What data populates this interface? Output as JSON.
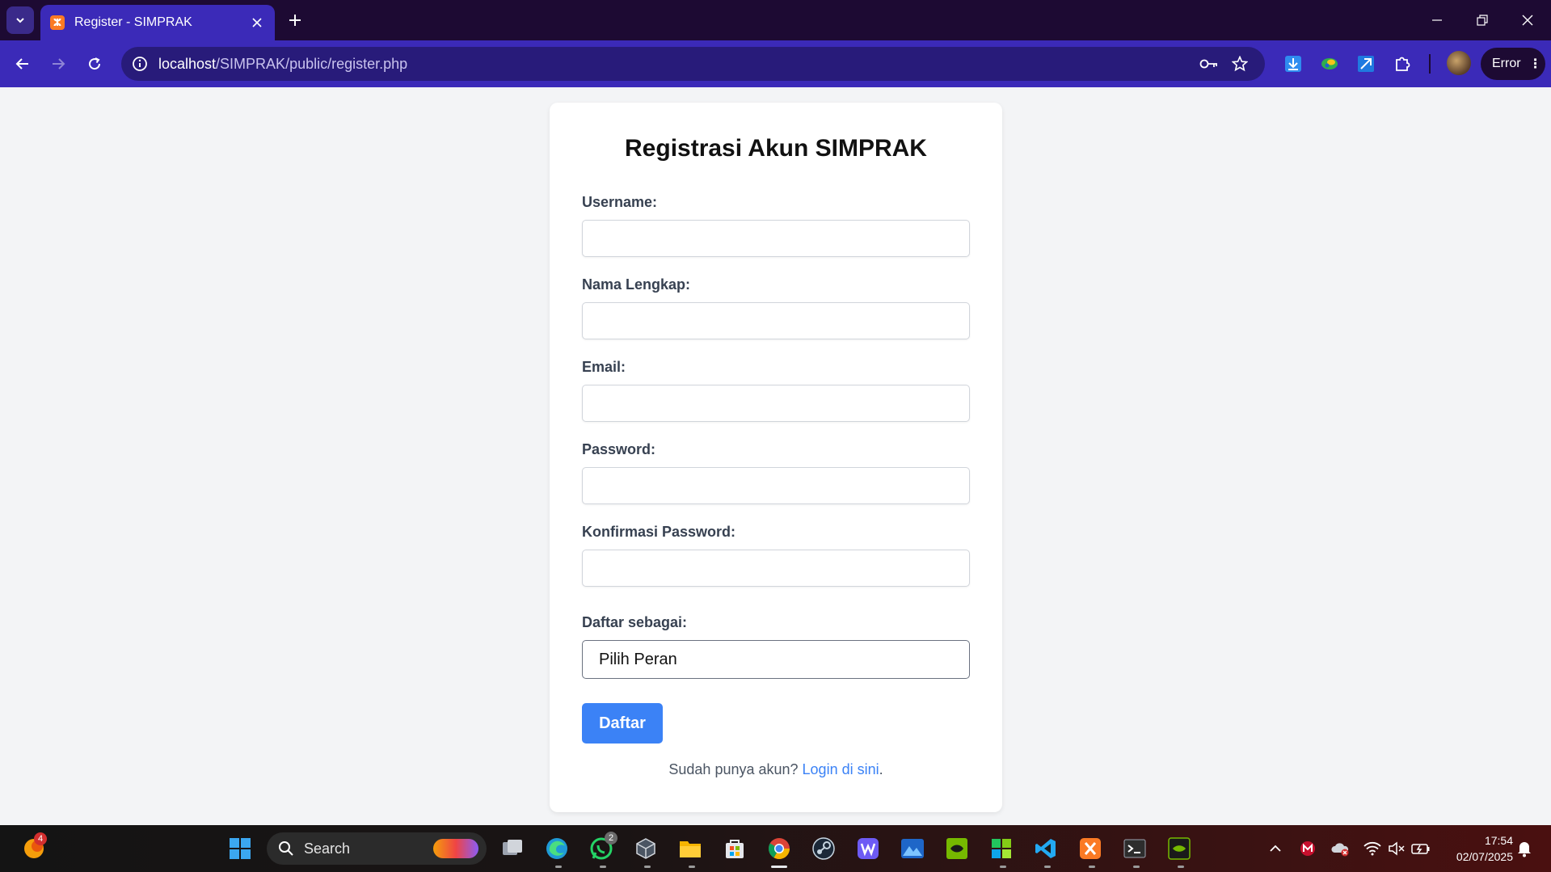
{
  "browser": {
    "tab_title": "Register - SIMPRAK",
    "url_host": "localhost",
    "url_path": "/SIMPRAK/public/register.php",
    "profile_status": "Error"
  },
  "form": {
    "title": "Registrasi Akun SIMPRAK",
    "username_label": "Username:",
    "fullname_label": "Nama Lengkap:",
    "email_label": "Email:",
    "password_label": "Password:",
    "confirm_label": "Konfirmasi Password:",
    "role_label": "Daftar sebagai:",
    "role_selected": "Pilih Peran",
    "submit_label": "Daftar",
    "footer_prefix": "Sudah punya akun? ",
    "footer_link": "Login di sini",
    "footer_suffix": "."
  },
  "taskbar": {
    "search_placeholder": "Search",
    "widgets_badge": "4",
    "whatsapp_badge": "2",
    "time": "17:54",
    "date": "02/07/2025"
  },
  "colors": {
    "chrome_frame": "#1d0a33",
    "chrome_toolbar": "#3b2ab8",
    "primary_button": "#3b82f6",
    "page_background": "#f3f4f6"
  }
}
